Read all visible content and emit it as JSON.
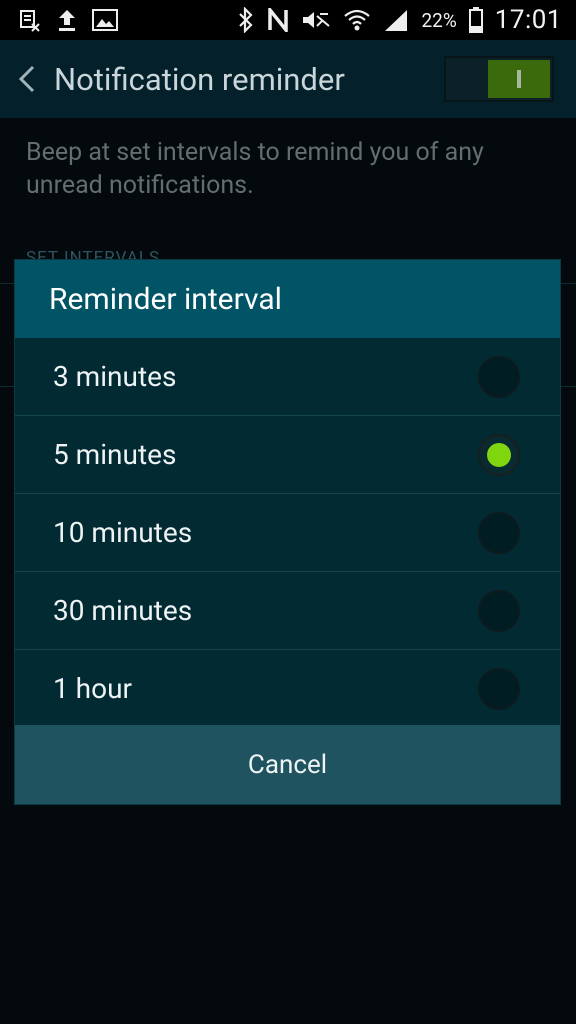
{
  "status_bar": {
    "battery_percent": "22%",
    "time": "17:01"
  },
  "header": {
    "title": "Notification reminder",
    "switch_on": true,
    "accent_color": "#3a6a0c"
  },
  "background": {
    "description": "Beep at set intervals to remind you of any unread notifications.",
    "section_header": "SET INTERVALS"
  },
  "dialog": {
    "title": "Reminder interval",
    "options": [
      {
        "label": "3 minutes",
        "selected": false
      },
      {
        "label": "5 minutes",
        "selected": true
      },
      {
        "label": "10 minutes",
        "selected": false
      },
      {
        "label": "30 minutes",
        "selected": false
      },
      {
        "label": "1 hour",
        "selected": false
      }
    ],
    "cancel_label": "Cancel",
    "selected_color": "#7fd60f"
  }
}
